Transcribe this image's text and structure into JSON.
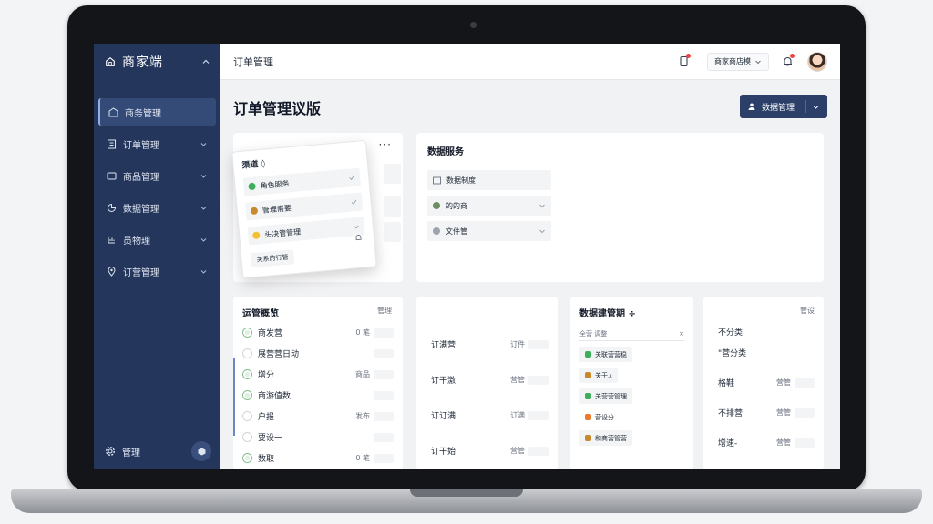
{
  "brand": {
    "name": "商家端"
  },
  "sidebar": {
    "items": [
      {
        "label": "商务管理",
        "icon": "store-icon"
      },
      {
        "label": "订单管理",
        "icon": "order-icon"
      },
      {
        "label": "商品管理",
        "icon": "product-icon"
      },
      {
        "label": "数据管理",
        "icon": "chart-icon"
      },
      {
        "label": "员物理",
        "icon": "staff-icon"
      },
      {
        "label": "订营管理",
        "icon": "location-icon"
      }
    ],
    "footer_label": "管理"
  },
  "topbar": {
    "breadcrumb": "订单管理",
    "store_select": "商家商店模"
  },
  "page": {
    "title": "订单管理议版",
    "primary_button": "数据管理"
  },
  "filter_panel": {
    "title": "渠道 ◊",
    "rows": [
      {
        "label": "角色服务",
        "color": "#3fae5a"
      },
      {
        "label": "管理需要",
        "color": "#c9892b"
      },
      {
        "label": "头决管管理",
        "color": "#f1c232"
      }
    ],
    "footer": "关系的行管"
  },
  "data_panel": {
    "title": "数据服务",
    "rows": [
      {
        "label": "数据制度"
      },
      {
        "label": "的的商"
      },
      {
        "label": "文件管"
      }
    ]
  },
  "orders_list": {
    "title": "运管概览",
    "link": "管理",
    "rows": [
      {
        "label": "商发营",
        "value": "0 笔",
        "ok": true
      },
      {
        "label": "展营营日动",
        "value": "",
        "ok": false
      },
      {
        "label": "增分",
        "value": "商品",
        "ok": true
      },
      {
        "label": "商游值数",
        "value": "",
        "ok": true
      },
      {
        "label": "户报",
        "value": "发布",
        "ok": false
      },
      {
        "label": "要设一",
        "value": "",
        "ok": false
      },
      {
        "label": "数取",
        "value": "0 笔",
        "ok": true
      }
    ]
  },
  "col1": {
    "link": "",
    "rows": [
      {
        "label": "订满营",
        "value": "订件"
      },
      {
        "label": "订干激",
        "value": "营管"
      },
      {
        "label": "订订满",
        "value": "订满"
      },
      {
        "label": "订干始",
        "value": "营管"
      }
    ]
  },
  "col2": {
    "title": "数据建管期 ÷",
    "search": "全营 调整",
    "tags": [
      {
        "label": "关联营营稳",
        "color": "#3fae5a"
      },
      {
        "label": "关于.\\",
        "color": "#c9892b"
      },
      {
        "label": "关营营管理",
        "color": "#3fae5a"
      },
      {
        "label": "营设分",
        "color": "#e97b2a"
      },
      {
        "label": "和商营管营",
        "color": "#c9892b"
      }
    ]
  },
  "col3": {
    "link": "管设",
    "rows": [
      {
        "label": "不分类",
        "value": ""
      },
      {
        "label": "\"营分类",
        "value": ""
      },
      {
        "label": "格鞋",
        "value": "营管"
      },
      {
        "label": "不排营",
        "value": "营管"
      },
      {
        "label": "增速-",
        "value": "营管"
      }
    ]
  }
}
